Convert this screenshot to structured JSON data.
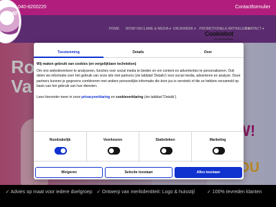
{
  "topbar": {
    "phone": "040-8200220",
    "contact": "Contactformulier"
  },
  "logo": {
    "text": "WOW!"
  },
  "nav": {
    "items": [
      {
        "label": "Home"
      },
      {
        "label": "WOW! Reclame & Media ▾"
      },
      {
        "label": "Drukwerk ▾"
      },
      {
        "label": "Promotionele artikelen ▾"
      },
      {
        "label": "Contact ▾"
      }
    ]
  },
  "hero": {
    "line1": "Ro",
    "line2": "Va",
    "right1": "W!",
    "right2": "OU"
  },
  "strip": {
    "items": [
      "✓ Advies op maat voor iedere doelgroep",
      "✓ Ontwerp van merkidentiteit: Logo & huisstijl",
      "✓ 100% tevreden klanten"
    ]
  },
  "cookie": {
    "brand_name": "Cookiebot",
    "brand_by": "by Usercentrics",
    "tabs": [
      "Toestemming",
      "Details",
      "Over"
    ],
    "title": "Wij maken gebruik van cookies (en vergelijkbare technieken)",
    "body": "Om ons websiteverkeer te analyseren, functies voor social media te bieden en om content en advertenties te personaliseren. Ook delen we informatie over het gebruik van onze site met partners (zie tabblad 'Details') voor social media, adverteren en analyse. Deze partners kunnen je gegevens combineren met andere persoonlijke informatie die door jou is verstrekt of die ze hebben verzameld op basis van het gebruik van hun diensten.",
    "more_prefix": "Lees hieronder meer in onze",
    "privacy_link": "privacyverklaring",
    "and": "en",
    "cookie_link": "cookieverklaring",
    "more_suffix": "(zie tabblad 'Details').",
    "switches": [
      {
        "label": "Noodzakelijk",
        "on": true
      },
      {
        "label": "Voorkeuren",
        "on": false
      },
      {
        "label": "Statistieken",
        "on": false
      },
      {
        "label": "Marketing",
        "on": false
      }
    ],
    "buttons": {
      "deny": "Weigeren",
      "select": "Selectie toestaan",
      "allow": "Alles toestaan"
    }
  },
  "colors": {
    "topbar": "#b11d7d",
    "nav": "#7a3a95",
    "accent": "#1032cf"
  }
}
